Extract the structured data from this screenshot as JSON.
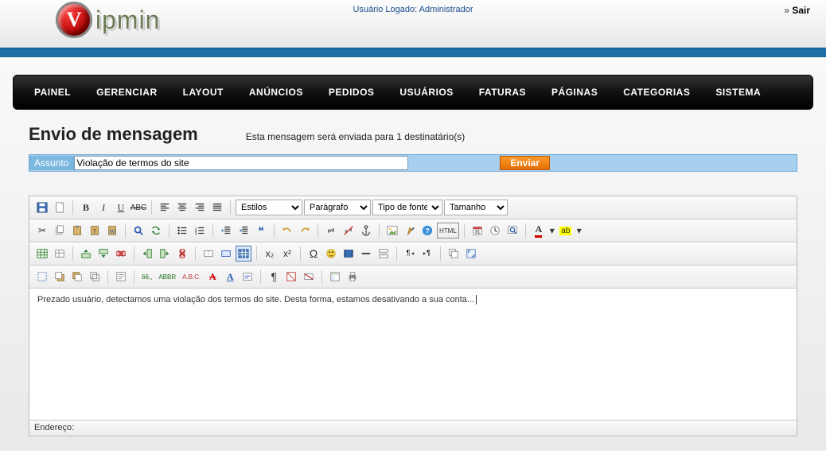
{
  "header": {
    "logged_label": "Usuário Logado:",
    "logged_user": "Administrador",
    "logout_prefix": "»",
    "logout_label": "Sair",
    "logo_badge": "V",
    "logo_text": "ipmin"
  },
  "nav": {
    "items": [
      "PAINEL",
      "GERENCIAR",
      "LAYOUT",
      "ANÚNCIOS",
      "PEDIDOS",
      "USUÁRIOS",
      "FATURAS",
      "PÁGINAS",
      "CATEGORIAS",
      "SISTEMA"
    ]
  },
  "page": {
    "title": "Envio de mensagem",
    "subtitle": "Esta mensagem será enviada para 1 destinatário(s)"
  },
  "form": {
    "subject_label": "Assunto",
    "subject_value": "Violação de termos do site",
    "send_label": "Enviar"
  },
  "editor": {
    "body": "Prezado usuário, detectamos uma violação dos termos do site. Desta forma, estamos desativando a sua conta...",
    "status_label": "Endereço:",
    "dropdowns": {
      "styles": "Estilos",
      "paragraph": "Parágrafo",
      "font": "Tipo de fonte",
      "size": "Tamanho"
    },
    "btn_labels": {
      "bold": "B",
      "italic": "I",
      "underline": "U",
      "strike": "ABC",
      "sub": "x₂",
      "sup": "x²",
      "omega": "Ω",
      "abbr1": "ABBR",
      "abbr2": "A.B.C.",
      "A_red": "A",
      "A_blue": "A",
      "A_fg": "A",
      "A_bg": "ab"
    }
  }
}
